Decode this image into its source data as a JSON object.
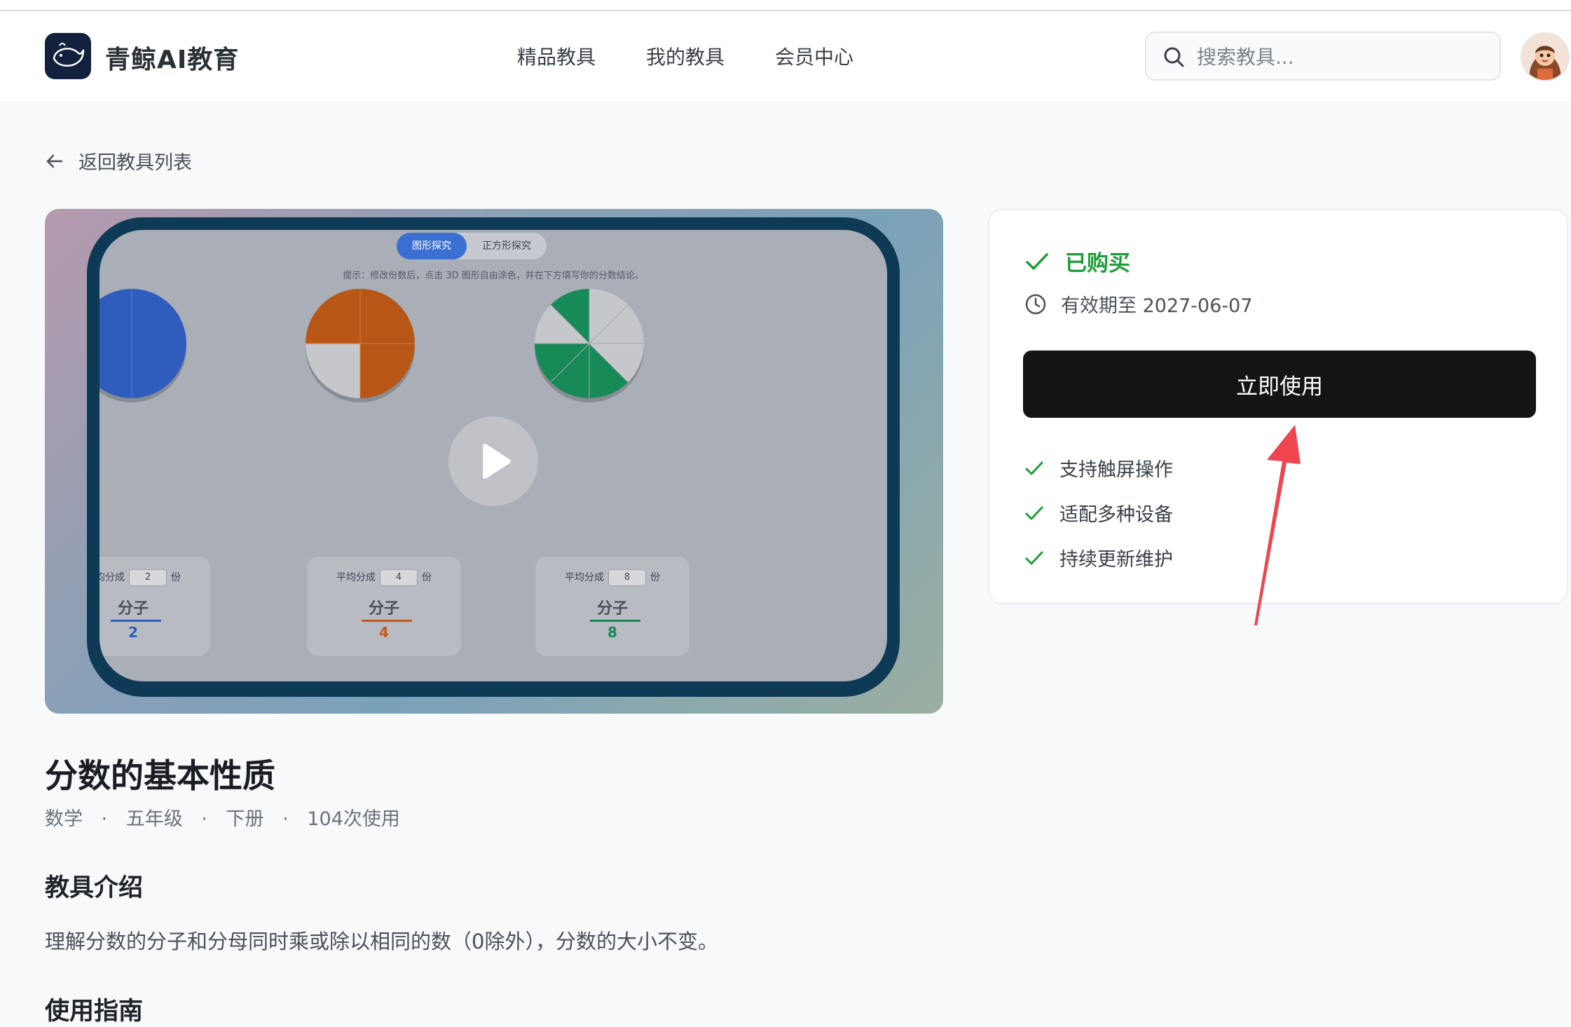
{
  "header": {
    "brand": "青鲸AI教育",
    "nav": [
      "精品教具",
      "我的教具",
      "会员中心"
    ],
    "search_placeholder": "搜索教具..."
  },
  "back_link": "返回教具列表",
  "preview": {
    "tabs": [
      "图形探究",
      "正方形探究"
    ],
    "hint": "提示：修改份数后，点击 3D 图形自由涂色，并在下方填写你的分数结论。",
    "cards": [
      {
        "prefix": "平均分成",
        "value": "2",
        "suffix": "份",
        "label": "分子",
        "numerator": "2",
        "color": "#2f5dbd"
      },
      {
        "prefix": "平均分成",
        "value": "4",
        "suffix": "份",
        "label": "分子",
        "numerator": "4",
        "color": "#c25a1a"
      },
      {
        "prefix": "平均分成",
        "value": "8",
        "suffix": "份",
        "label": "分子",
        "numerator": "8",
        "color": "#178a58"
      }
    ]
  },
  "purchase": {
    "status": "已购买",
    "validity": "有效期至 2027-06-07",
    "use_button": "立即使用",
    "features": [
      "支持触屏操作",
      "适配多种设备",
      "持续更新维护"
    ],
    "accent": "#1f9d3a"
  },
  "tool": {
    "title": "分数的基本性质",
    "meta": [
      "数学",
      "·",
      "五年级",
      "·",
      "下册",
      "·",
      "104次使用"
    ],
    "intro_heading": "教具介绍",
    "intro_text": "理解分数的分子和分母同时乘或除以相同的数（0除外），分数的大小不变。",
    "guide_heading": "使用指南"
  }
}
